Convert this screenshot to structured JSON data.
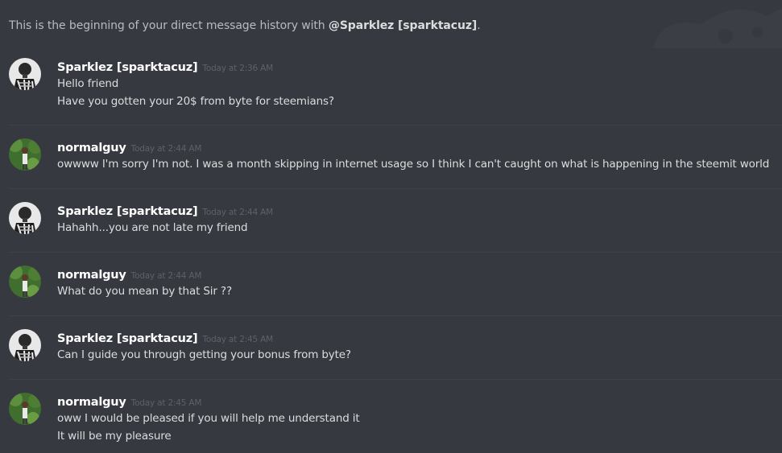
{
  "intro": {
    "prefix": "This is the beginning of your direct message history with ",
    "handle": "@Sparklez [sparktacuz]",
    "suffix": "."
  },
  "messages": [
    {
      "author": "Sparklez [sparktacuz]",
      "timestamp": "Today at 2:36 AM",
      "avatar": "sparklez-avatar",
      "lines": [
        "Hello friend",
        "Have you gotten your 20$ from byte for steemians?"
      ]
    },
    {
      "author": "normalguy",
      "timestamp": "Today at 2:44 AM",
      "avatar": "normalguy-avatar",
      "lines": [
        "owwww I'm sorry I'm not. I was a month skipping in internet usage so I think I can't caught on what is happening in the steemit world"
      ]
    },
    {
      "author": "Sparklez [sparktacuz]",
      "timestamp": "Today at 2:44 AM",
      "avatar": "sparklez-avatar",
      "lines": [
        "Hahahh...you are not late my friend"
      ]
    },
    {
      "author": "normalguy",
      "timestamp": "Today at 2:44 AM",
      "avatar": "normalguy-avatar",
      "lines": [
        "What do you mean by that Sir ??"
      ]
    },
    {
      "author": "Sparklez [sparktacuz]",
      "timestamp": "Today at 2:45 AM",
      "avatar": "sparklez-avatar",
      "lines": [
        "Can I guide you through getting your bonus from byte?"
      ]
    },
    {
      "author": "normalguy",
      "timestamp": "Today at 2:45 AM",
      "avatar": "normalguy-avatar",
      "lines": [
        "oww I would be pleased if you will help me understand it",
        "It will be my pleasure"
      ]
    }
  ],
  "colors": {
    "background": "#36393f",
    "text": "#dcddde",
    "username": "#ffffff",
    "timestamp": "#5e6166",
    "divider": "#3e4147"
  }
}
